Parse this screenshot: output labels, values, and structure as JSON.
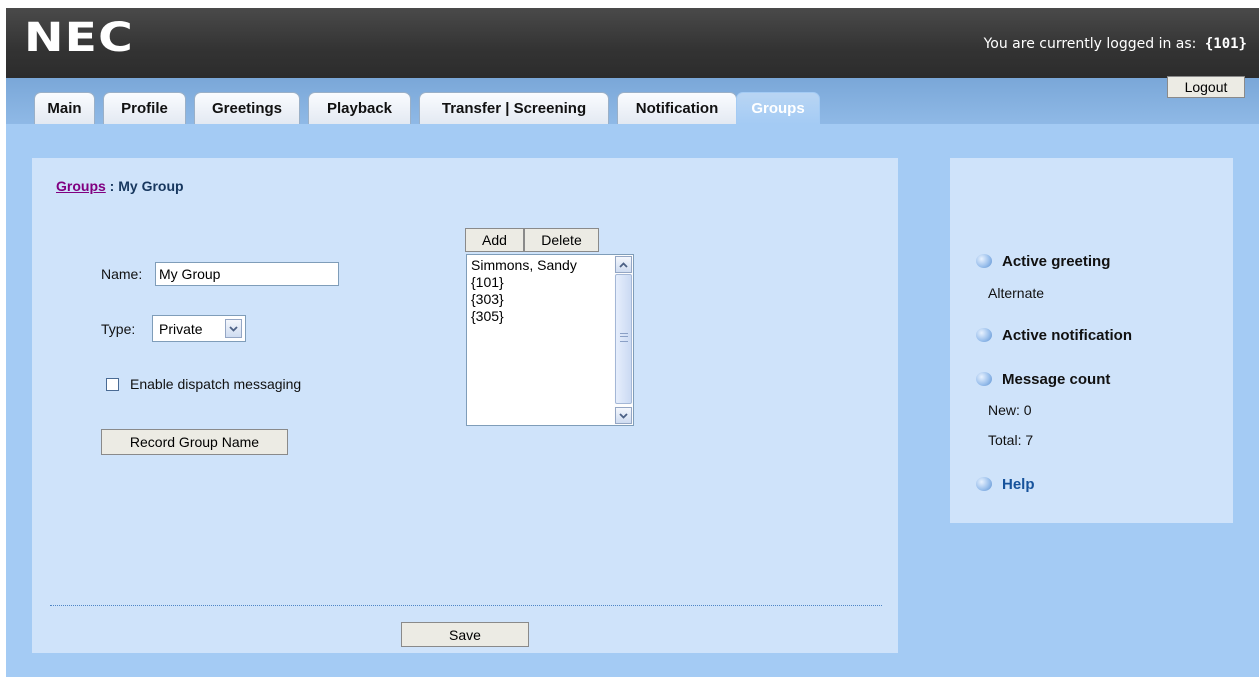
{
  "header": {
    "logo": "NEC",
    "login_status_text": "You are currently logged in as:",
    "login_user": "{101}"
  },
  "tabs": [
    {
      "label": "Main",
      "active": false
    },
    {
      "label": "Profile",
      "active": false
    },
    {
      "label": "Greetings",
      "active": false
    },
    {
      "label": "Playback",
      "active": false
    },
    {
      "label": "Transfer | Screening",
      "active": false
    },
    {
      "label": "Notification",
      "active": false
    },
    {
      "label": "Groups",
      "active": true
    }
  ],
  "logout_label": "Logout",
  "breadcrumb": {
    "link": "Groups",
    "separator": " : ",
    "current": "My Group"
  },
  "form": {
    "name_label": "Name:",
    "name_value": "My Group",
    "type_label": "Type:",
    "type_value": "Private",
    "dispatch_label": "Enable dispatch messaging",
    "dispatch_checked": false,
    "record_button": "Record Group Name",
    "save_button": "Save"
  },
  "members": {
    "add_label": "Add",
    "delete_label": "Delete",
    "items": [
      "Simmons, Sandy",
      "{101}",
      "{303}",
      "{305}"
    ]
  },
  "sidebar": {
    "active_greeting_title": "Active greeting",
    "active_greeting_value": "Alternate",
    "active_notification_title": "Active notification",
    "message_count_title": "Message count",
    "new_label": "New: 0",
    "total_label": "Total: 7",
    "help_label": "Help"
  },
  "colors": {
    "page_background": "#a4cbf4",
    "panel_background": "#cfe3fa",
    "header_background": "#333333",
    "link_visited": "#800080",
    "help_link": "#17539c"
  }
}
